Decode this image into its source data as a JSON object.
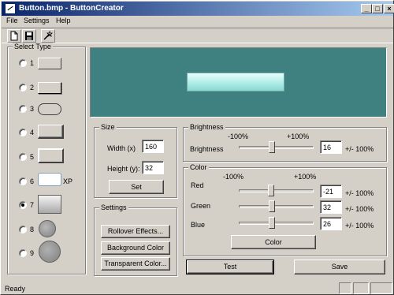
{
  "window": {
    "title": "Button.bmp - ButtonCreator"
  },
  "caption_buttons": {
    "minimize": "_",
    "maximize": "□",
    "close": "×"
  },
  "menu": {
    "file": "File",
    "settings": "Settings",
    "help": "Help"
  },
  "toolbar": {
    "icons": [
      "new-document-icon",
      "save-disk-icon",
      "wand-icon"
    ]
  },
  "select_type": {
    "title": "Select Type",
    "items": [
      {
        "label": "1",
        "selected": false
      },
      {
        "label": "2",
        "selected": false
      },
      {
        "label": "3",
        "selected": false
      },
      {
        "label": "4",
        "selected": false
      },
      {
        "label": "5",
        "selected": false
      },
      {
        "label": "6",
        "selected": false,
        "extra": "XP"
      },
      {
        "label": "7",
        "selected": true
      },
      {
        "label": "8",
        "selected": false
      },
      {
        "label": "9",
        "selected": false
      }
    ]
  },
  "preview": {
    "background": "#3f8080",
    "button_color": "#b8f0ec"
  },
  "size": {
    "title": "Size",
    "width_label": "Width (x)",
    "width_value": "160",
    "height_label": "Height (y):",
    "height_value": "32",
    "set_button": "Set"
  },
  "settings": {
    "title": "Settings",
    "rollover": "Rollover Effects...",
    "background": "Background Color",
    "transparent": "Transparent Color..."
  },
  "brightness": {
    "title": "Brightness",
    "min": "-100%",
    "max": "+100%",
    "label": "Brightness",
    "value": "16",
    "range": "+/- 100%"
  },
  "color": {
    "title": "Color",
    "min": "-100%",
    "max": "+100%",
    "red_label": "Red",
    "red_value": "-21",
    "red_range": "+/- 100%",
    "green_label": "Green",
    "green_value": "32",
    "green_range": "+/- 100%",
    "blue_label": "Blue",
    "blue_value": "26",
    "blue_range": "+/- 100%",
    "color_button": "Color"
  },
  "actions": {
    "test": "Test",
    "save": "Save"
  },
  "status": {
    "text": "Ready"
  }
}
